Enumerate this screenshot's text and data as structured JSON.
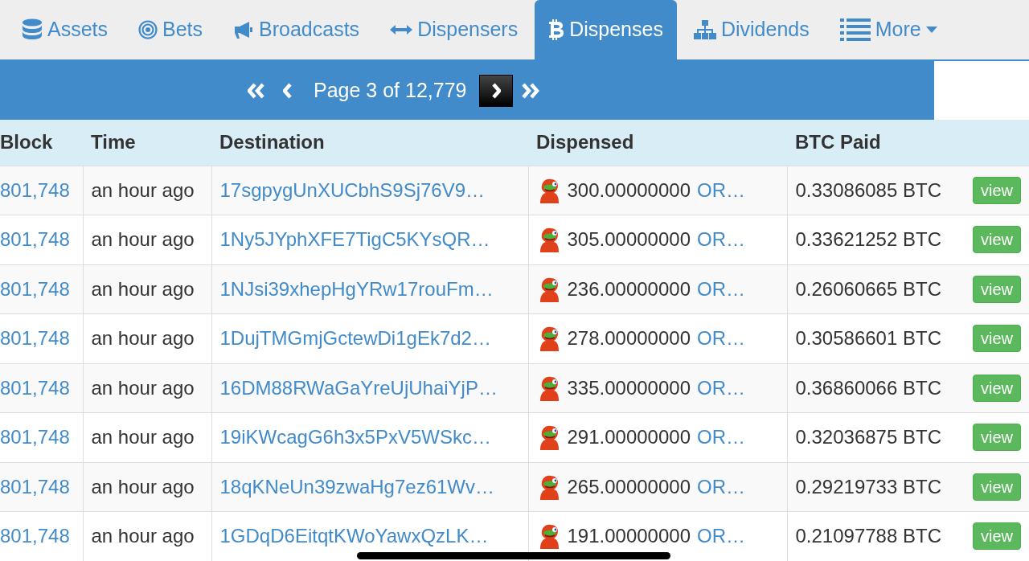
{
  "tabs": [
    {
      "label": "Assets",
      "kind": "database",
      "selected": false,
      "dropdown": false
    },
    {
      "label": "Bets",
      "kind": "target",
      "selected": false,
      "dropdown": false
    },
    {
      "label": "Broadcasts",
      "kind": "megaphone",
      "selected": false,
      "dropdown": false
    },
    {
      "label": "Dispensers",
      "kind": "arrows",
      "selected": false,
      "dropdown": false
    },
    {
      "label": "Dispenses",
      "kind": "bitcoin",
      "selected": true,
      "dropdown": false
    },
    {
      "label": "Dividends",
      "kind": "sitemap",
      "selected": false,
      "dropdown": false
    },
    {
      "label": "More",
      "kind": "list",
      "selected": false,
      "dropdown": true
    }
  ],
  "pager": {
    "label": "Page 3 of 12,779",
    "buttons": [
      {
        "kind": "first",
        "highlighted": false
      },
      {
        "kind": "prev",
        "highlighted": false
      },
      {
        "kind": "next",
        "highlighted": true
      },
      {
        "kind": "last",
        "highlighted": false
      }
    ]
  },
  "table": {
    "columns": [
      "Block",
      "Time",
      "Destination",
      "Dispensed",
      "BTC Paid"
    ],
    "rows": [
      {
        "block": "801,748",
        "time": "an hour ago",
        "destination": "17sgpygUnXUCbhS9Sj76V9…",
        "amount": "300.00000000",
        "asset": "OR…",
        "btc": "0.33086085 BTC",
        "action": "view"
      },
      {
        "block": "801,748",
        "time": "an hour ago",
        "destination": "1Ny5JYphXFE7TigC5KYsQR…",
        "amount": "305.00000000",
        "asset": "OR…",
        "btc": "0.33621252 BTC",
        "action": "view"
      },
      {
        "block": "801,748",
        "time": "an hour ago",
        "destination": "1NJsi39xhepHgYRw17rouFm…",
        "amount": "236.00000000",
        "asset": "OR…",
        "btc": "0.26060665 BTC",
        "action": "view"
      },
      {
        "block": "801,748",
        "time": "an hour ago",
        "destination": "1DujTMGmjGctewDi1gEk7d2…",
        "amount": "278.00000000",
        "asset": "OR…",
        "btc": "0.30586601 BTC",
        "action": "view"
      },
      {
        "block": "801,748",
        "time": "an hour ago",
        "destination": "16DM88RWaGaYreUjUhaiYjP…",
        "amount": "335.00000000",
        "asset": "OR…",
        "btc": "0.36860066 BTC",
        "action": "view"
      },
      {
        "block": "801,748",
        "time": "an hour ago",
        "destination": "19iKWcagG6h3x5PxV5WSkc…",
        "amount": "291.00000000",
        "asset": "OR…",
        "btc": "0.32036875 BTC",
        "action": "view"
      },
      {
        "block": "801,748",
        "time": "an hour ago",
        "destination": "18qKNeUn39zwaHg7ez61Wv…",
        "amount": "265.00000000",
        "asset": "OR…",
        "btc": "0.29219733 BTC",
        "action": "view"
      },
      {
        "block": "801,748",
        "time": "an hour ago",
        "destination": "1GDqD6EitqtKWoYawxQzLK…",
        "amount": "191.00000000",
        "asset": "OR…",
        "btc": "0.21097788 BTC",
        "action": "view"
      }
    ]
  }
}
